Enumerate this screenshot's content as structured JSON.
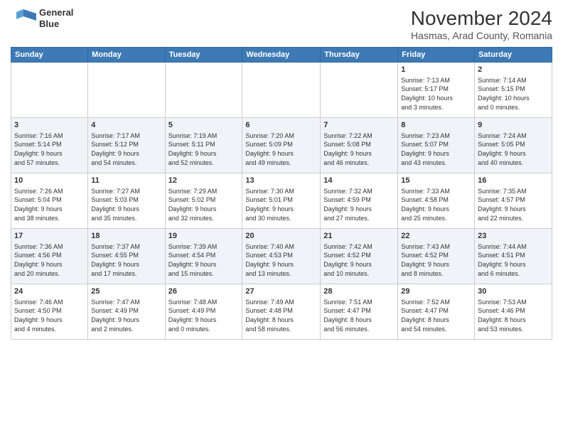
{
  "header": {
    "logo_line1": "General",
    "logo_line2": "Blue",
    "month_title": "November 2024",
    "location": "Hasmas, Arad County, Romania"
  },
  "weekdays": [
    "Sunday",
    "Monday",
    "Tuesday",
    "Wednesday",
    "Thursday",
    "Friday",
    "Saturday"
  ],
  "weeks": [
    [
      {
        "day": "",
        "info": ""
      },
      {
        "day": "",
        "info": ""
      },
      {
        "day": "",
        "info": ""
      },
      {
        "day": "",
        "info": ""
      },
      {
        "day": "",
        "info": ""
      },
      {
        "day": "1",
        "info": "Sunrise: 7:13 AM\nSunset: 5:17 PM\nDaylight: 10 hours\nand 3 minutes."
      },
      {
        "day": "2",
        "info": "Sunrise: 7:14 AM\nSunset: 5:15 PM\nDaylight: 10 hours\nand 0 minutes."
      }
    ],
    [
      {
        "day": "3",
        "info": "Sunrise: 7:16 AM\nSunset: 5:14 PM\nDaylight: 9 hours\nand 57 minutes."
      },
      {
        "day": "4",
        "info": "Sunrise: 7:17 AM\nSunset: 5:12 PM\nDaylight: 9 hours\nand 54 minutes."
      },
      {
        "day": "5",
        "info": "Sunrise: 7:19 AM\nSunset: 5:11 PM\nDaylight: 9 hours\nand 52 minutes."
      },
      {
        "day": "6",
        "info": "Sunrise: 7:20 AM\nSunset: 5:09 PM\nDaylight: 9 hours\nand 49 minutes."
      },
      {
        "day": "7",
        "info": "Sunrise: 7:22 AM\nSunset: 5:08 PM\nDaylight: 9 hours\nand 46 minutes."
      },
      {
        "day": "8",
        "info": "Sunrise: 7:23 AM\nSunset: 5:07 PM\nDaylight: 9 hours\nand 43 minutes."
      },
      {
        "day": "9",
        "info": "Sunrise: 7:24 AM\nSunset: 5:05 PM\nDaylight: 9 hours\nand 40 minutes."
      }
    ],
    [
      {
        "day": "10",
        "info": "Sunrise: 7:26 AM\nSunset: 5:04 PM\nDaylight: 9 hours\nand 38 minutes."
      },
      {
        "day": "11",
        "info": "Sunrise: 7:27 AM\nSunset: 5:03 PM\nDaylight: 9 hours\nand 35 minutes."
      },
      {
        "day": "12",
        "info": "Sunrise: 7:29 AM\nSunset: 5:02 PM\nDaylight: 9 hours\nand 32 minutes."
      },
      {
        "day": "13",
        "info": "Sunrise: 7:30 AM\nSunset: 5:01 PM\nDaylight: 9 hours\nand 30 minutes."
      },
      {
        "day": "14",
        "info": "Sunrise: 7:32 AM\nSunset: 4:59 PM\nDaylight: 9 hours\nand 27 minutes."
      },
      {
        "day": "15",
        "info": "Sunrise: 7:33 AM\nSunset: 4:58 PM\nDaylight: 9 hours\nand 25 minutes."
      },
      {
        "day": "16",
        "info": "Sunrise: 7:35 AM\nSunset: 4:57 PM\nDaylight: 9 hours\nand 22 minutes."
      }
    ],
    [
      {
        "day": "17",
        "info": "Sunrise: 7:36 AM\nSunset: 4:56 PM\nDaylight: 9 hours\nand 20 minutes."
      },
      {
        "day": "18",
        "info": "Sunrise: 7:37 AM\nSunset: 4:55 PM\nDaylight: 9 hours\nand 17 minutes."
      },
      {
        "day": "19",
        "info": "Sunrise: 7:39 AM\nSunset: 4:54 PM\nDaylight: 9 hours\nand 15 minutes."
      },
      {
        "day": "20",
        "info": "Sunrise: 7:40 AM\nSunset: 4:53 PM\nDaylight: 9 hours\nand 13 minutes."
      },
      {
        "day": "21",
        "info": "Sunrise: 7:42 AM\nSunset: 4:52 PM\nDaylight: 9 hours\nand 10 minutes."
      },
      {
        "day": "22",
        "info": "Sunrise: 7:43 AM\nSunset: 4:52 PM\nDaylight: 9 hours\nand 8 minutes."
      },
      {
        "day": "23",
        "info": "Sunrise: 7:44 AM\nSunset: 4:51 PM\nDaylight: 9 hours\nand 6 minutes."
      }
    ],
    [
      {
        "day": "24",
        "info": "Sunrise: 7:46 AM\nSunset: 4:50 PM\nDaylight: 9 hours\nand 4 minutes."
      },
      {
        "day": "25",
        "info": "Sunrise: 7:47 AM\nSunset: 4:49 PM\nDaylight: 9 hours\nand 2 minutes."
      },
      {
        "day": "26",
        "info": "Sunrise: 7:48 AM\nSunset: 4:49 PM\nDaylight: 9 hours\nand 0 minutes."
      },
      {
        "day": "27",
        "info": "Sunrise: 7:49 AM\nSunset: 4:48 PM\nDaylight: 8 hours\nand 58 minutes."
      },
      {
        "day": "28",
        "info": "Sunrise: 7:51 AM\nSunset: 4:47 PM\nDaylight: 8 hours\nand 56 minutes."
      },
      {
        "day": "29",
        "info": "Sunrise: 7:52 AM\nSunset: 4:47 PM\nDaylight: 8 hours\nand 54 minutes."
      },
      {
        "day": "30",
        "info": "Sunrise: 7:53 AM\nSunset: 4:46 PM\nDaylight: 8 hours\nand 53 minutes."
      }
    ]
  ]
}
